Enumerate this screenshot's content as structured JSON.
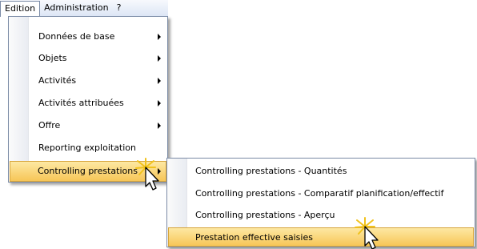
{
  "menubar": {
    "items": [
      {
        "label": "Edition",
        "active": true
      },
      {
        "label": "Administration",
        "active": false
      },
      {
        "label": "?",
        "active": false
      }
    ]
  },
  "edition_menu": {
    "items": [
      {
        "label": "Données de base",
        "submenu": true
      },
      {
        "label": "Objets",
        "submenu": true
      },
      {
        "label": "Activités",
        "submenu": true
      },
      {
        "label": "Activités attribuées",
        "submenu": true
      },
      {
        "label": "Offre",
        "submenu": true
      },
      {
        "label": "Reporting exploitation",
        "submenu": false
      },
      {
        "label": "Controlling prestations",
        "submenu": true,
        "highlighted": true
      }
    ]
  },
  "controlling_submenu": {
    "items": [
      {
        "label": "Controlling prestations - Quantités"
      },
      {
        "label": "Controlling prestations - Comparatif planification/effectif"
      },
      {
        "label": "Controlling prestations - Aperçu"
      },
      {
        "label": "Prestation effective saisies",
        "highlighted": true
      }
    ]
  },
  "colors": {
    "highlight_top": "#fde8a3",
    "highlight_bottom": "#f7c657",
    "menu_border": "#7b8ba6",
    "menubar_bg": "#dde6f5"
  }
}
